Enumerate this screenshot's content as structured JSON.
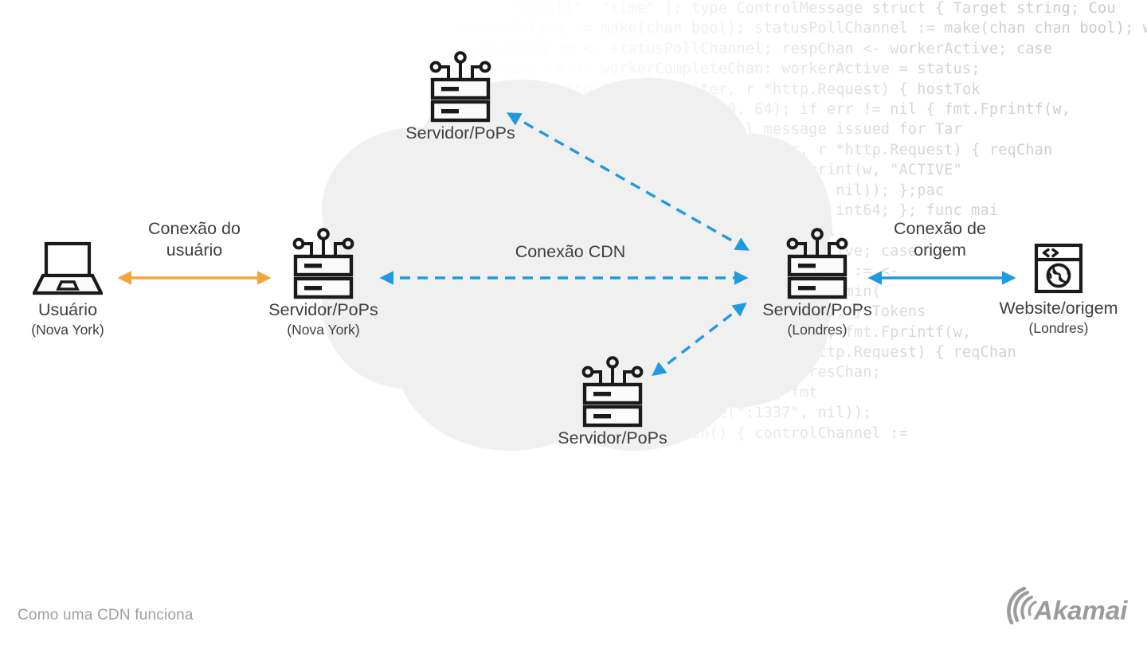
{
  "meta": {
    "caption": "Como uma CDN funciona",
    "brand": "Akamai",
    "colors": {
      "cloud": "#f0f0f0",
      "user_link": "#f5a33c",
      "cdn_link": "#1f9ae0",
      "origin_link": "#1f9ae0",
      "text": "#3c4043",
      "caption": "#9e9e9e",
      "brand": "#9b9b9b",
      "code_watermark": "#9aa0a6"
    }
  },
  "diagram": {
    "type": "network-topology",
    "cloud_label": "Conexão CDN",
    "nodes": [
      {
        "id": "user",
        "icon": "laptop-icon",
        "label": "Usuário",
        "sublabel": "(Nova York)"
      },
      {
        "id": "pop-newyork",
        "icon": "server-pop-icon",
        "label": "Servidor/PoPs",
        "sublabel": "(Nova York)"
      },
      {
        "id": "pop-top",
        "icon": "server-pop-icon",
        "label": "Servidor/PoPs",
        "sublabel": ""
      },
      {
        "id": "pop-bottom",
        "icon": "server-pop-icon",
        "label": "Servidor/PoPs",
        "sublabel": ""
      },
      {
        "id": "pop-london",
        "icon": "server-pop-icon",
        "label": "Servidor/PoPs",
        "sublabel": "(Londres)"
      },
      {
        "id": "origin",
        "icon": "browser-globe-icon",
        "label": "Website/origem",
        "sublabel": "(Londres)"
      }
    ],
    "links": [
      {
        "id": "user-connection",
        "label": "Conexão do\nusuário",
        "style": "solid",
        "color": "#f5a33c",
        "arrows": "both",
        "from": "user",
        "to": "pop-newyork"
      },
      {
        "id": "cdn-connection-main",
        "label": "Conexão CDN",
        "style": "dashed",
        "color": "#1f9ae0",
        "arrows": "both",
        "from": "pop-newyork",
        "to": "pop-london"
      },
      {
        "id": "cdn-connection-top",
        "label": "",
        "style": "dashed",
        "color": "#1f9ae0",
        "arrows": "both",
        "from": "pop-top",
        "to": "pop-london"
      },
      {
        "id": "cdn-connection-bottom",
        "label": "",
        "style": "dashed",
        "color": "#1f9ae0",
        "arrows": "both",
        "from": "pop-bottom",
        "to": "pop-london"
      },
      {
        "id": "origin-connection",
        "label": "Conexão de\norigem",
        "style": "solid",
        "color": "#1f9ae0",
        "arrows": "both",
        "from": "pop-london",
        "to": "origin"
      }
    ]
  },
  "background_code": "            \"result\"  \"time\" ]; type ControlMessage struct { Target string; Cou\n      workerActive := make(chan bool); statusPollChannel := make(chan chan bool); w\n        respChan := <- statusPollChannel; respChan <- workerActive; case\n    case status := <- workerCompleteChan: workerActive = status;\n    func admin(w http.ResponseWriter, r *http.Request) { hostTok\n    ParseInt(r.FormValue(\"count\"), 10, 64); if err != nil { fmt.Fprintf(w,\n       } else { fmt.Fprintf(w, \"Control message issued for Tar\n    func statusHandler(w http.ResponseWriter, r *http.Request) { reqChan\n        reqChan <- resChan; if result { fmt.Fprint(w, \"ACTIVE\"\n         log.Fatal(http.ListenAndServe(\":1337\", nil)); };pac\n   ControlMessage struct { Target string; Count int64; }; func mai\n     workerActive := make(chan bool); workerActi\n        statusPollChannel; respChan <- workerActive; case\n    w http.ResponseWriter, r *http.Request) { msg := <-\n     hostTokens := strings.Split(r.Host, \":\"); admin(\n     if err != nil { fmt.Fprintf(w, err.Error()); } Tokens\n         \"Control message issued for Target %s\", fmt.Fprintf(w,\n     statusHandler(w http.ResponseWriter, r *http.Request) { reqChan\n      resChan := make(chan bool); reqChan <- resChan;\n         fmt.Fprint(w, \"ACTIVE\"); } else { fmt\n       log.Fatal(http.ListenAndServe(\":1337\", nil));\n         Count int64; }; func main() { controlChannel :=\n     workerCompleteChan := make(chan bool); statusPollCha\n      case respChan := <- statusPollChannel; respChan <-"
}
